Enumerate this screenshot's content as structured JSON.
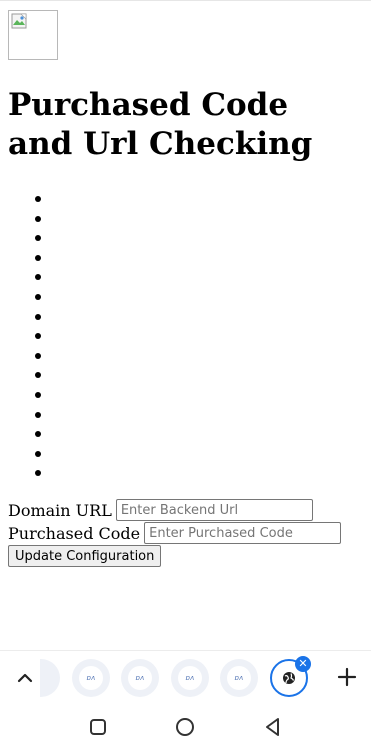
{
  "page": {
    "title": "Purchased Code and Url Checking",
    "image_alt": "",
    "bullet_count": 15
  },
  "form": {
    "domain_label": "Domain URL",
    "domain_placeholder": "Enter Backend Url",
    "domain_value": "",
    "code_label": "Purchased Code",
    "code_placeholder": "Enter Purchased Code",
    "code_value": "",
    "submit_label": "Update Configuration"
  },
  "browser": {
    "tabs": [
      {
        "kind": "partial",
        "favicon": "site-favicon"
      },
      {
        "kind": "thumb",
        "favicon": "site-favicon"
      },
      {
        "kind": "thumb",
        "favicon": "site-favicon"
      },
      {
        "kind": "thumb",
        "favicon": "site-favicon"
      },
      {
        "kind": "thumb",
        "favicon": "site-favicon"
      },
      {
        "kind": "active",
        "favicon": "globe-icon"
      }
    ],
    "new_tab_icon": "plus-icon",
    "collapse_icon": "chevron-up-icon",
    "close_glyph": "✕",
    "accent": "#1a73e8"
  },
  "system_nav": {
    "recent": "square-icon",
    "home": "circle-icon",
    "back": "triangle-back-icon"
  }
}
